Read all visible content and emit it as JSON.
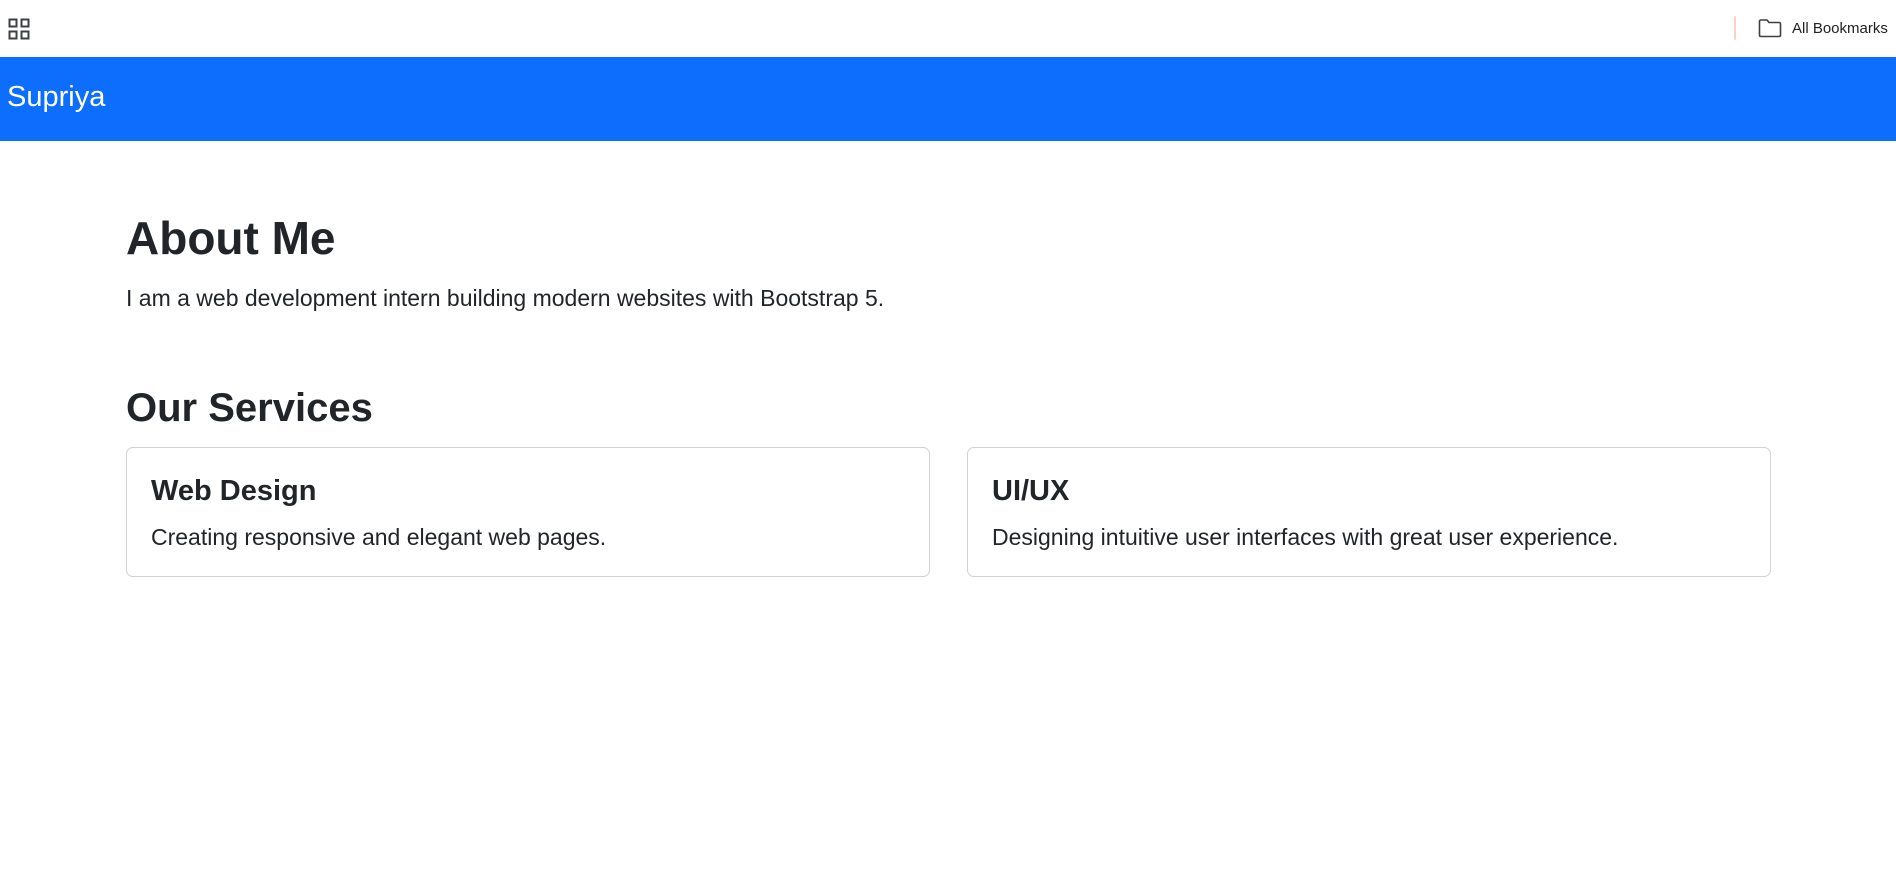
{
  "bookmarks_bar": {
    "apps_icon": "apps-grid-icon",
    "all_bookmarks_label": "All Bookmarks",
    "folder_icon": "folder-icon"
  },
  "navbar": {
    "brand": "Supriya",
    "background_color": "#0d6efd"
  },
  "about": {
    "title": "About Me",
    "text": "I am a web development intern building modern websites with Bootstrap 5."
  },
  "services": {
    "title": "Our Services",
    "cards": [
      {
        "title": "Web Design",
        "text": "Creating responsive and elegant web pages."
      },
      {
        "title": "UI/UX",
        "text": "Designing intuitive user interfaces with great user experience."
      }
    ]
  }
}
